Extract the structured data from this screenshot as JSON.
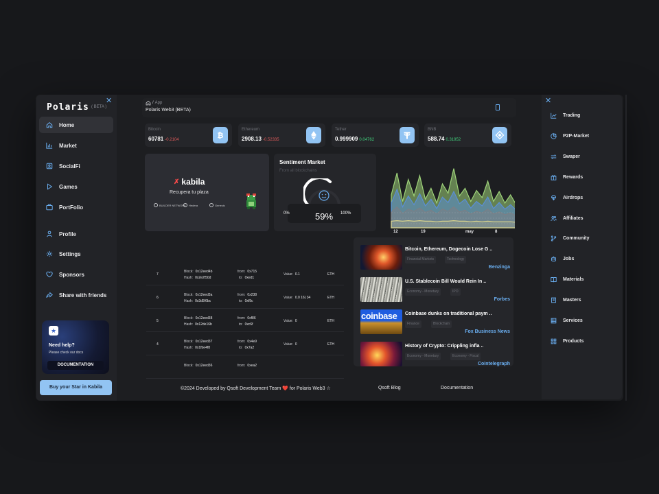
{
  "brand": {
    "logo": "Polaris",
    "beta": "( BETA )"
  },
  "left_nav": [
    {
      "label": "Home",
      "icon": "home-icon"
    },
    {
      "label": "Market",
      "icon": "bar-chart-icon"
    },
    {
      "label": "SocialFi",
      "icon": "id-card-icon"
    },
    {
      "label": "Games",
      "icon": "play-icon"
    },
    {
      "label": "PortFolio",
      "icon": "briefcase-icon"
    },
    {
      "label": "Profile",
      "icon": "user-icon"
    },
    {
      "label": "Settings",
      "icon": "gear-icon"
    },
    {
      "label": "Sponsors",
      "icon": "heart-icon"
    },
    {
      "label": "Share with friends",
      "icon": "share-icon"
    }
  ],
  "help": {
    "title": "Need help?",
    "subtitle": "Please check our docs",
    "button": "DOCUMENTATION"
  },
  "buy_button": "Buy your Star in Kabila",
  "header": {
    "breadcrumb_sep": "/",
    "breadcrumb_page": "App",
    "title": "Polaris Web3 (BETA)"
  },
  "coins": [
    {
      "name": "Bitcoin",
      "price": "60781",
      "change": "-0.2104",
      "direction": "down",
      "icon": "bitcoin-icon"
    },
    {
      "name": "Ethereum",
      "price": "2908.13",
      "change": "-0.52335",
      "direction": "down",
      "icon": "ethereum-icon"
    },
    {
      "name": "Tether",
      "price": "0.999909",
      "change": "0.04762",
      "direction": "up",
      "icon": "tether-icon"
    },
    {
      "name": "BNB",
      "price": "588.74",
      "change": "0.31952",
      "direction": "up",
      "icon": "bnb-icon"
    }
  ],
  "kabila": {
    "logo": "kabila",
    "subtitle": "Recupera tu plaza",
    "partners": [
      "BUILDER NETWORK",
      "Hedera",
      "Genesis"
    ]
  },
  "sentiment": {
    "title": "Sentiment Market",
    "subtitle": "From all blockchains",
    "min": "0%",
    "value": "59%",
    "max": "100%",
    "level": 0.59
  },
  "chart_data": {
    "type": "area",
    "x_ticks": [
      "12",
      "19",
      "may",
      "8"
    ],
    "series": [
      {
        "color": "#9fd47a",
        "values": [
          60,
          100,
          48,
          88,
          58,
          95,
          52,
          72,
          45,
          80,
          63,
          108,
          58,
          72,
          48,
          68,
          55,
          85,
          48,
          66,
          45,
          60,
          42
        ]
      },
      {
        "color": "#5b8fd6",
        "values": [
          45,
          70,
          38,
          58,
          42,
          62,
          40,
          52,
          35,
          56,
          46,
          66,
          44,
          52,
          36,
          48,
          40,
          56,
          35,
          46,
          34,
          42,
          32
        ]
      },
      {
        "color": "#7c7f86",
        "values": [
          28,
          38,
          26,
          34,
          30,
          36,
          28,
          32,
          25,
          34,
          30,
          38,
          29,
          32,
          25,
          30,
          27,
          34,
          25,
          29,
          24,
          27,
          22
        ]
      },
      {
        "color": "#d8d38c",
        "values": [
          12,
          13,
          12,
          13,
          12,
          13,
          12,
          12,
          11,
          12,
          12,
          13,
          12,
          12,
          11,
          12,
          11,
          12,
          11,
          11,
          11,
          11,
          10
        ]
      }
    ]
  },
  "transactions": [
    {
      "index": "7",
      "block": "0x12eed4b",
      "hash": "0x2e2f50d",
      "from": "0x715",
      "to": "0xed1",
      "value": "0.1",
      "token": "ETH"
    },
    {
      "index": "6",
      "block": "0x12eed3a",
      "hash": "0x3d5f6bc",
      "from": "0x238",
      "to": "0xf9c",
      "value": "0.0 16) 34",
      "token": "ETH"
    },
    {
      "index": "5",
      "block": "0x12eed38",
      "hash": "0x12de16b",
      "from": "0xf86",
      "to": "0xc6f",
      "value": "0",
      "token": "ETH"
    },
    {
      "index": "4",
      "block": "0x12eed37",
      "hash": "0x1fbe4f8",
      "from": "0x4e9",
      "to": "0x7a2",
      "value": "0",
      "token": "ETH"
    },
    {
      "index": "",
      "block": "0x12eed36",
      "hash": "",
      "from": "0xea2",
      "to": "",
      "value": "",
      "token": ""
    }
  ],
  "tx_labels": {
    "block": "Block:",
    "hash": "Hash:",
    "from": "from:",
    "to": "to:",
    "value": "Value:"
  },
  "news": [
    {
      "title": "Bitcoin, Ethereum, Dogecoin Lose G ..",
      "tags": [
        "Financial Markets",
        "Technology"
      ],
      "source": "Benzinga",
      "image": "planet-explosion"
    },
    {
      "title": "U.S. Stablecoin Bill Would Rein In ..",
      "tags": [
        "Economy - Monetary",
        "IPO"
      ],
      "source": "Forbes",
      "image": "dollar-bills"
    },
    {
      "title": "Coinbase dunks on traditional paym ..",
      "tags": [
        "Finance",
        "Blockchain"
      ],
      "source": "Fox Business News",
      "image": "coinbase-coins",
      "image_text": "coinbase"
    },
    {
      "title": "History of Crypto: Crippling infla ..",
      "tags": [
        "Economy - Monetary",
        "Economy - Fiscal"
      ],
      "source": "Cointelegraph",
      "image": "crypto-fire"
    }
  ],
  "footer": {
    "credit": "©2024 Developed by Qsoft Development Team ❤️ for Polaris Web3 ☆",
    "blog": "Qsoft Blog",
    "docs": "Documentation"
  },
  "right_nav": [
    {
      "label": "Trading",
      "icon": "trend-icon"
    },
    {
      "label": "P2P-Market",
      "icon": "pie-icon"
    },
    {
      "label": "Swaper",
      "icon": "swap-icon"
    },
    {
      "label": "Rewards",
      "icon": "gift-icon"
    },
    {
      "label": "Airdrops",
      "icon": "parachute-icon"
    },
    {
      "label": "Affiliates",
      "icon": "users-icon"
    },
    {
      "label": "Community",
      "icon": "branch-icon"
    },
    {
      "label": "Jobs",
      "icon": "robot-icon"
    },
    {
      "label": "Materials",
      "icon": "book-icon"
    },
    {
      "label": "Masters",
      "icon": "book-icon"
    },
    {
      "label": "Services",
      "icon": "server-icon"
    },
    {
      "label": "Products",
      "icon": "grid-icon"
    }
  ]
}
